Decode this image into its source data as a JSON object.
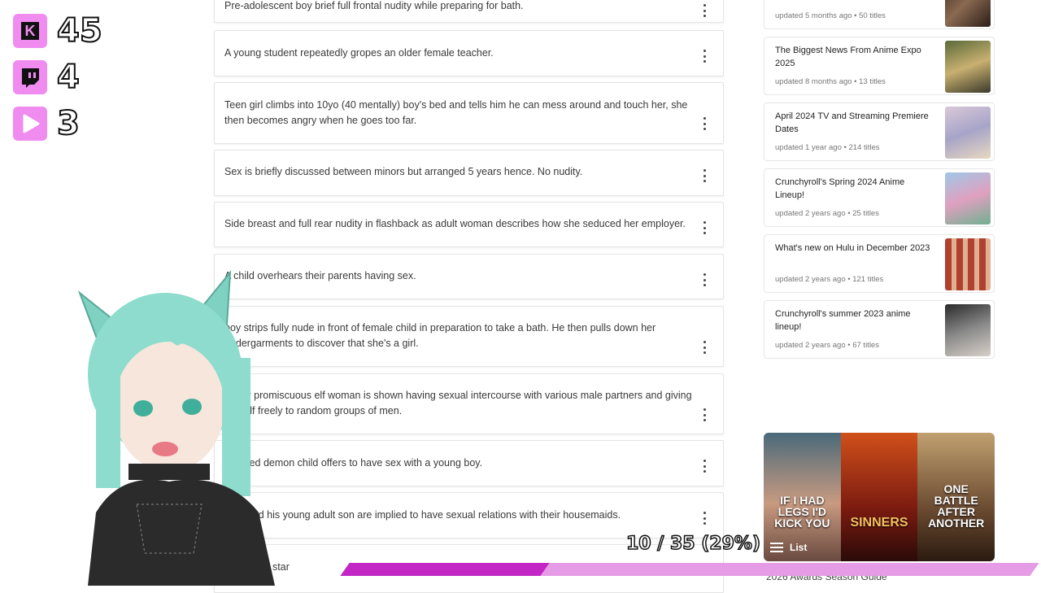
{
  "counters": [
    {
      "icon": "kick-icon",
      "value": "45"
    },
    {
      "icon": "twitch-icon",
      "value": "4"
    },
    {
      "icon": "rumble-icon",
      "value": "3"
    }
  ],
  "warnings": [
    "Pre-adolescent boy brief full frontal nudity while preparing for bath.",
    "A young student repeatedly gropes an older female teacher.",
    "Teen girl climbs into 10yo (40 mentally) boy's bed and tells him he can mess around and touch her, she then becomes angry when he goes too far.",
    "Sex is briefly discussed between minors but arranged 5 years hence. No nudity.",
    "Side breast and full rear nudity in flashback as adult woman describes how she seduced her employer.",
    "A child overhears their parents having sex.",
    "boy strips fully nude in front of female child in preparation to take a bath. He then pulls down her undergarments to discover that she's a girl.",
    "highly promiscuous elf woman is shown having sexual intercourse with various male partners and giving herself freely to random groups of men.",
    "dressed demon child offers to have sex with a young boy.",
    "man and his young adult son are implied to have sexual relations with their housemaids.",
    "d his child star"
  ],
  "side_lists": [
    {
      "title": "",
      "meta": "updated 5 months ago • 50 titles"
    },
    {
      "title": "The Biggest News From Anime Expo 2025",
      "meta": "updated 8 months ago • 13 titles"
    },
    {
      "title": "April 2024 TV and Streaming Premiere Dates",
      "meta": "updated 1 year ago • 214 titles"
    },
    {
      "title": "Crunchyroll's Spring 2024 Anime Lineup!",
      "meta": "updated 2 years ago • 25 titles"
    },
    {
      "title": "What's new on Hulu in December 2023",
      "meta": "updated 2 years ago • 121 titles"
    },
    {
      "title": "Crunchyroll's summer 2023 anime lineup!",
      "meta": "updated 2 years ago • 67 titles"
    }
  ],
  "banner": {
    "posters": [
      "IF I HAD LEGS I'D KICK YOU",
      "SINNERS",
      "ONE BATTLE AFTER ANOTHER"
    ],
    "list_label": "List"
  },
  "bottom_link": "2026 Awards Season Guide",
  "progress": {
    "label": "10 / 35 (29%)",
    "fraction": 0.29
  },
  "colors": {
    "accent": "#c227c6",
    "accent_light": "#e59be5",
    "counter_bg": "#f08bf0"
  }
}
